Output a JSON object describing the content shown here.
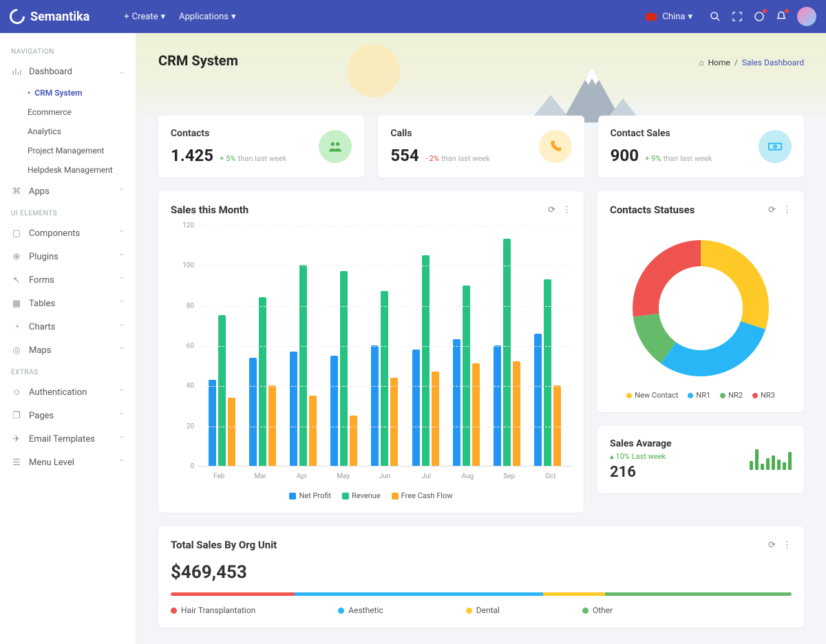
{
  "brand": "Semantika",
  "topbar": {
    "create": "Create",
    "applications": "Applications",
    "country": "China"
  },
  "sidebar": {
    "headings": {
      "nav": "NAVIGATION",
      "ui": "UI ELEMENTS",
      "extras": "EXTRAS"
    },
    "dashboard": "Dashboard",
    "subs": [
      "CRM System",
      "Ecommerce",
      "Analytics",
      "Project Management",
      "Helpdesk Management"
    ],
    "apps": "Apps",
    "components": "Components",
    "plugins": "Plugins",
    "forms": "Forms",
    "tables": "Tables",
    "charts": "Charts",
    "maps": "Maps",
    "auth": "Authentication",
    "pages": "Pages",
    "email": "Email Templates",
    "menu": "Menu Level"
  },
  "hero": {
    "title": "CRM System"
  },
  "crumbs": {
    "home": "Home",
    "sep": "/",
    "last": "Sales Dashboard"
  },
  "stats": {
    "contacts": {
      "label": "Contacts",
      "value": "1.425",
      "delta": "+ 5%",
      "suffix": "than last week"
    },
    "calls": {
      "label": "Calls",
      "value": "554",
      "delta": "- 2%",
      "suffix": "than last week"
    },
    "sales": {
      "label": "Contact Sales",
      "value": "900",
      "delta": "+ 9%",
      "suffix": "than last week"
    }
  },
  "sales_chart": {
    "title": "Sales this Month"
  },
  "donut": {
    "title": "Contacts Statuses",
    "items": [
      "New Contact",
      "NR1",
      "NR2",
      "NR3"
    ]
  },
  "avg": {
    "title": "Sales Avarage",
    "pct": "10% Last week",
    "value": "216"
  },
  "org": {
    "title": "Total Sales By Org Unit",
    "value": "$469,453",
    "items": [
      "Hair Transplantation",
      "Aesthetic",
      "Dental",
      "Other"
    ]
  },
  "chart_data": [
    {
      "type": "bar",
      "title": "Sales this Month",
      "ylim": [
        0,
        120
      ],
      "yticks": [
        0,
        20,
        40,
        60,
        80,
        100,
        120
      ],
      "categories": [
        "Feb",
        "Mar",
        "Apr",
        "May",
        "Jun",
        "Jul",
        "Aug",
        "Sep",
        "Oct"
      ],
      "series": [
        {
          "name": "Net Profit",
          "color": "#2196f3",
          "values": [
            43,
            54,
            57,
            55,
            60,
            58,
            63,
            60,
            66
          ]
        },
        {
          "name": "Revenue",
          "color": "#26c281",
          "values": [
            75,
            84,
            100,
            97,
            87,
            105,
            90,
            113,
            93
          ]
        },
        {
          "name": "Free Cash Flow",
          "color": "#ffa726",
          "values": [
            34,
            40,
            35,
            25,
            44,
            47,
            51,
            52,
            40
          ]
        }
      ]
    },
    {
      "type": "pie",
      "title": "Contacts Statuses",
      "series": [
        {
          "name": "New Contact",
          "value": 30,
          "color": "#ffca28"
        },
        {
          "name": "NR1",
          "value": 30,
          "color": "#29b6f6"
        },
        {
          "name": "NR2",
          "value": 13,
          "color": "#66bb6a"
        },
        {
          "name": "NR3",
          "value": 27,
          "color": "#ef5350"
        }
      ]
    },
    {
      "type": "bar",
      "title": "Sales Avarage mini",
      "categories": [
        1,
        2,
        3,
        4,
        5,
        6,
        7,
        8
      ],
      "values": [
        12,
        28,
        8,
        16,
        20,
        14,
        10,
        24
      ]
    },
    {
      "type": "bar",
      "title": "Total Sales By Org Unit",
      "series": [
        {
          "name": "Hair Transplantation",
          "value": 20,
          "color": "#ef5350"
        },
        {
          "name": "Aesthetic",
          "value": 40,
          "color": "#29b6f6"
        },
        {
          "name": "Dental",
          "value": 10,
          "color": "#ffca28"
        },
        {
          "name": "Other",
          "value": 30,
          "color": "#66bb6a"
        }
      ]
    }
  ]
}
